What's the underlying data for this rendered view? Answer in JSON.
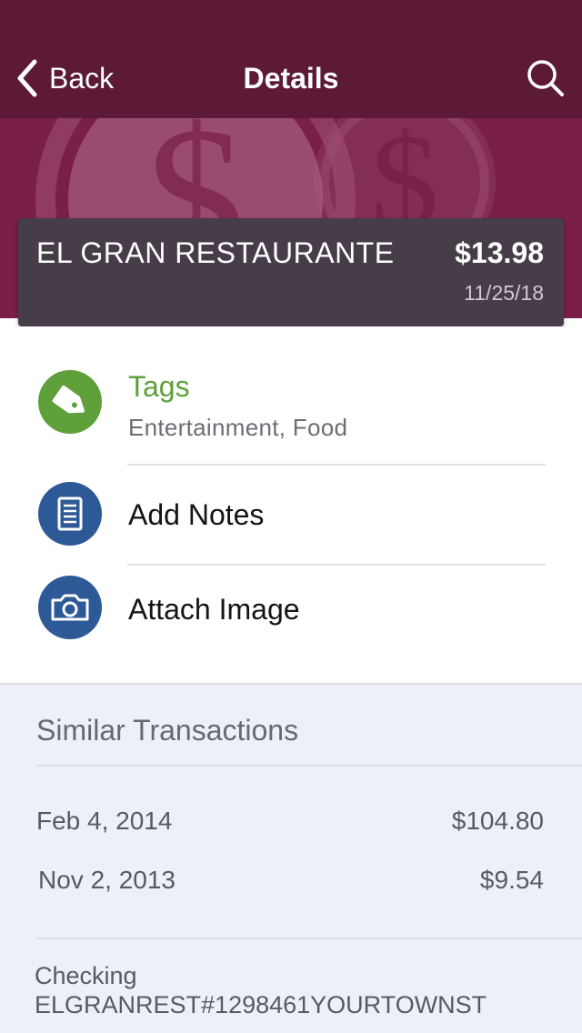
{
  "navbar": {
    "back_label": "Back",
    "title": "Details",
    "search_icon": "search-icon"
  },
  "colors": {
    "navbar": "#5c1a36",
    "hero": "#7a1f47",
    "tags_green": "#5fa03a",
    "icon_blue": "#2d5996",
    "similar_bg": "#edf1f7"
  },
  "merchant": {
    "name": "EL GRAN RESTAURANTE",
    "amount": "$13.98",
    "date": "11/25/18"
  },
  "actions": {
    "tags": {
      "icon": "tag-icon",
      "label": "Tags",
      "value": "Entertainment, Food"
    },
    "notes": {
      "icon": "notes-icon",
      "label": "Add Notes"
    },
    "image": {
      "icon": "camera-icon",
      "label": "Attach Image"
    }
  },
  "similar": {
    "title": "Similar Transactions",
    "transactions": [
      {
        "date": "Feb 4, 2014",
        "amount": "$104.80"
      },
      {
        "date": "Nov 2, 2013",
        "amount": "$9.54"
      }
    ],
    "account_type": "Checking",
    "account_description": "ELGRANREST#1298461YOURTOWNST"
  }
}
